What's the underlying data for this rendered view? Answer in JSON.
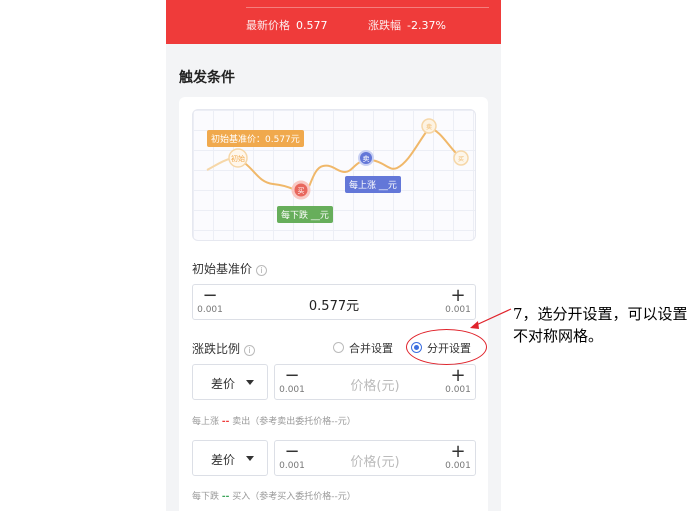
{
  "header": {
    "latest_price_label": "最新价格",
    "latest_price": "0.577",
    "change_label": "涨跌幅",
    "change": "-2.37%"
  },
  "section_title": "触发条件",
  "chart": {
    "base_tag": "初始基准价：0.577元",
    "up_tag": "每上涨 __元",
    "down_tag": "每下跌 __元",
    "node_start": "初始",
    "node_buy": "买",
    "node_sell": "卖",
    "node_sell2": "卖",
    "node_right": "买",
    "colors": {
      "base": "#f0a94d",
      "up": "#6377d8",
      "down": "#67ae5b",
      "buy": "#e8665c"
    }
  },
  "base_price": {
    "label": "初始基准价",
    "value": "0.577元",
    "minus_step": "0.001",
    "plus_step": "0.001"
  },
  "ratio": {
    "label": "涨跌比例",
    "option_merge": "合并设置",
    "option_split": "分开设置",
    "selected": "分开设置"
  },
  "up_row": {
    "select_value": "差价",
    "placeholder": "价格(元)",
    "minus_step": "0.001",
    "plus_step": "0.001",
    "hint_prefix": "每上涨",
    "hint_dash": "--",
    "hint_suffix": "卖出（参考卖出委托价格--元）"
  },
  "down_row": {
    "select_value": "差价",
    "placeholder": "价格(元)",
    "minus_step": "0.001",
    "plus_step": "0.001",
    "hint_prefix": "每下跌",
    "hint_dash": "--",
    "hint_suffix": "买入（参考买入委托价格--元）"
  },
  "annotation": {
    "text": "7，选分开设置，可以设置不对称网格。"
  }
}
